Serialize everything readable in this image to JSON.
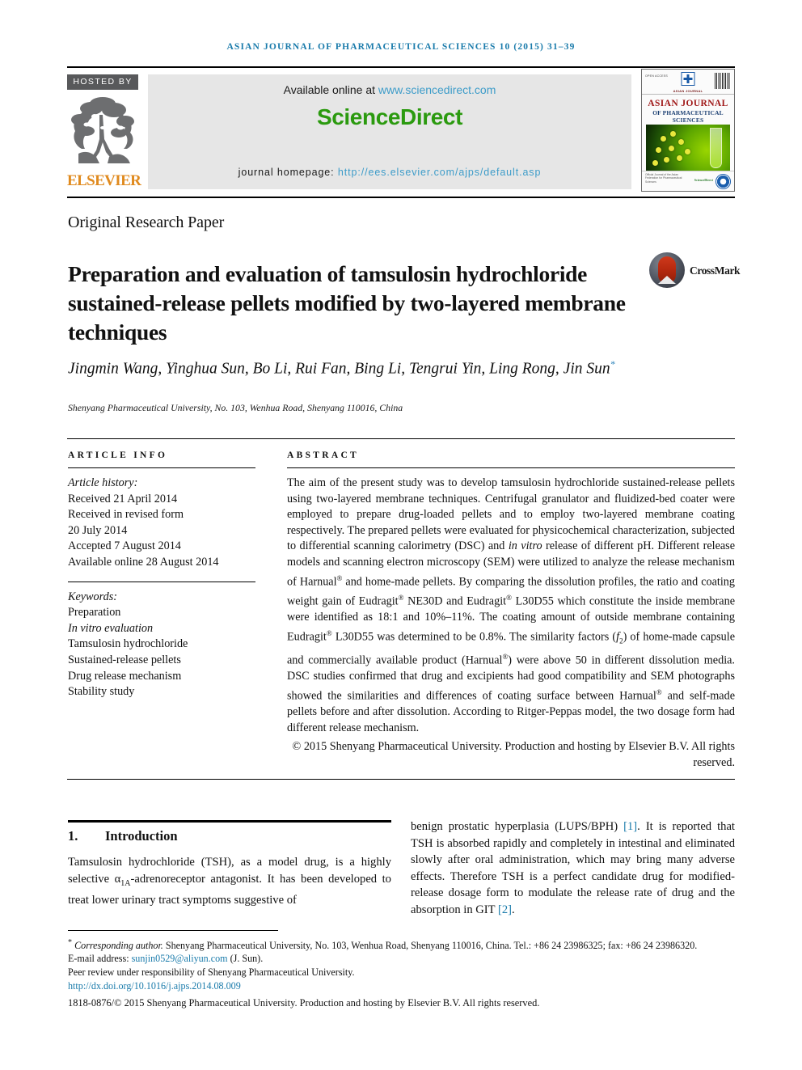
{
  "running_head": "ASIAN JOURNAL OF PHARMACEUTICAL SCIENCES 10 (2015) 31–39",
  "masthead": {
    "hosted_by": "HOSTED BY",
    "elsevier_word": "ELSEVIER",
    "available_prefix": "Available online at ",
    "available_url": "www.sciencedirect.com",
    "sciencedirect_logo": "ScienceDirect",
    "homepage_label": "journal homepage: ",
    "homepage_url": "http://ees.elsevier.com/ajps/default.asp",
    "sd_green": "#2b9a0f",
    "link_blue": "#3d9cc9"
  },
  "cover": {
    "title_line1": "ASIAN JOURNAL",
    "title_line2": "OF PHARMACEUTICAL SCIENCES",
    "association": "ASIAN JOURNAL",
    "top_left_label": "OPEN ACCESS",
    "foot_text": "Official Journal of the Asian Federation for Pharmaceutical Sciences",
    "elsevier_mini": "ScienceDirect"
  },
  "article": {
    "type": "Original Research Paper",
    "title": "Preparation and evaluation of tamsulosin hydrochloride sustained-release pellets modified by two-layered membrane techniques",
    "crossmark_label": "CrossMark",
    "authors": "Jingmin Wang, Yinghua Sun, Bo Li, Rui Fan, Bing Li, Tengrui Yin, Ling Rong, Jin Sun",
    "author_marker": "*",
    "affiliation": "Shenyang Pharmaceutical University, No. 103, Wenhua Road, Shenyang 110016, China"
  },
  "article_info": {
    "heading": "ARTICLE INFO",
    "history_label": "Article history:",
    "history": [
      "Received 21 April 2014",
      "Received in revised form",
      "20 July 2014",
      "Accepted 7 August 2014",
      "Available online 28 August 2014"
    ],
    "keywords_label": "Keywords:",
    "keywords": [
      "Preparation",
      "In vitro evaluation",
      "Tamsulosin hydrochloride",
      "Sustained-release pellets",
      "Drug release mechanism",
      "Stability study"
    ]
  },
  "abstract": {
    "heading": "ABSTRACT",
    "text_part1": "The aim of the present study was to develop tamsulosin hydrochloride sustained-release pellets using two-layered membrane techniques. Centrifugal granulator and fluidized-bed coater were employed to prepare drug-loaded pellets and to employ two-layered membrane coating respectively. The prepared pellets were evaluated for physicochemical characterization, subjected to differential scanning calorimetry (DSC) and ",
    "text_italic1": "in vitro",
    "text_part2": " release of different pH. Different release models and scanning electron microscopy (SEM) were utilized to analyze the release mechanism of Harnual",
    "reg1": "®",
    "text_part3": " and home-made pellets. By comparing the dissolution profiles, the ratio and coating weight gain of Eudragit",
    "reg2": "®",
    "text_part4": " NE30D and Eudragit",
    "reg3": "®",
    "text_part5": " L30D55 which constitute the inside membrane were identified as 18:1 and 10%–11%. The coating amount of outside membrane containing Eudragit",
    "reg4": "®",
    "text_part6": " L30D55 was determined to be 0.8%. The similarity factors (",
    "f2_italic": "f",
    "f2_sub": "2",
    "text_part7": ") of home-made capsule and commercially available product (Harnual",
    "reg5": "®",
    "text_part8": ") were above 50 in different dissolution media. DSC studies confirmed that drug and excipients had good compatibility and SEM photographs showed the similarities and differences of coating surface between Harnual",
    "reg6": "®",
    "text_part9": " and self-made pellets before and after dissolution. According to Ritger-Peppas model, the two dosage form had different release mechanism.",
    "copyright": "© 2015 Shenyang Pharmaceutical University. Production and hosting by Elsevier B.V. All rights reserved."
  },
  "body": {
    "section_number": "1.",
    "section_title": "Introduction",
    "left_part1": "Tamsulosin hydrochloride (TSH), as a model drug, is a highly selective α",
    "left_sub": "1A",
    "left_part2": "-adrenoreceptor antagonist. It has been developed to treat lower urinary tract symptoms suggestive of",
    "right_part1": "benign prostatic hyperplasia (LUPS/BPH) ",
    "right_ref1": "[1]",
    "right_part2": ". It is reported that TSH is absorbed rapidly and completely in intestinal and eliminated slowly after oral administration, which may bring many adverse effects. Therefore TSH is a perfect candidate drug for modified-release dosage form to modulate the release rate of drug and the absorption in GIT ",
    "right_ref2": "[2]",
    "right_part3": "."
  },
  "footnotes": {
    "corresponding_marker": "*",
    "corresponding_italic": "Corresponding author.",
    "corresponding_rest": " Shenyang Pharmaceutical University, No. 103, Wenhua Road, Shenyang 110016, China. Tel.: +86 24 23986325; fax: +86 24 23986320.",
    "email_label": "E-mail address: ",
    "email": "sunjin0529@aliyun.com",
    "email_suffix": " (J. Sun).",
    "peer_review": "Peer review under responsibility of Shenyang Pharmaceutical University.",
    "doi": "http://dx.doi.org/10.1016/j.ajps.2014.08.009",
    "issn_line": "1818-0876/© 2015 Shenyang Pharmaceutical University. Production and hosting by Elsevier B.V. All rights reserved."
  }
}
